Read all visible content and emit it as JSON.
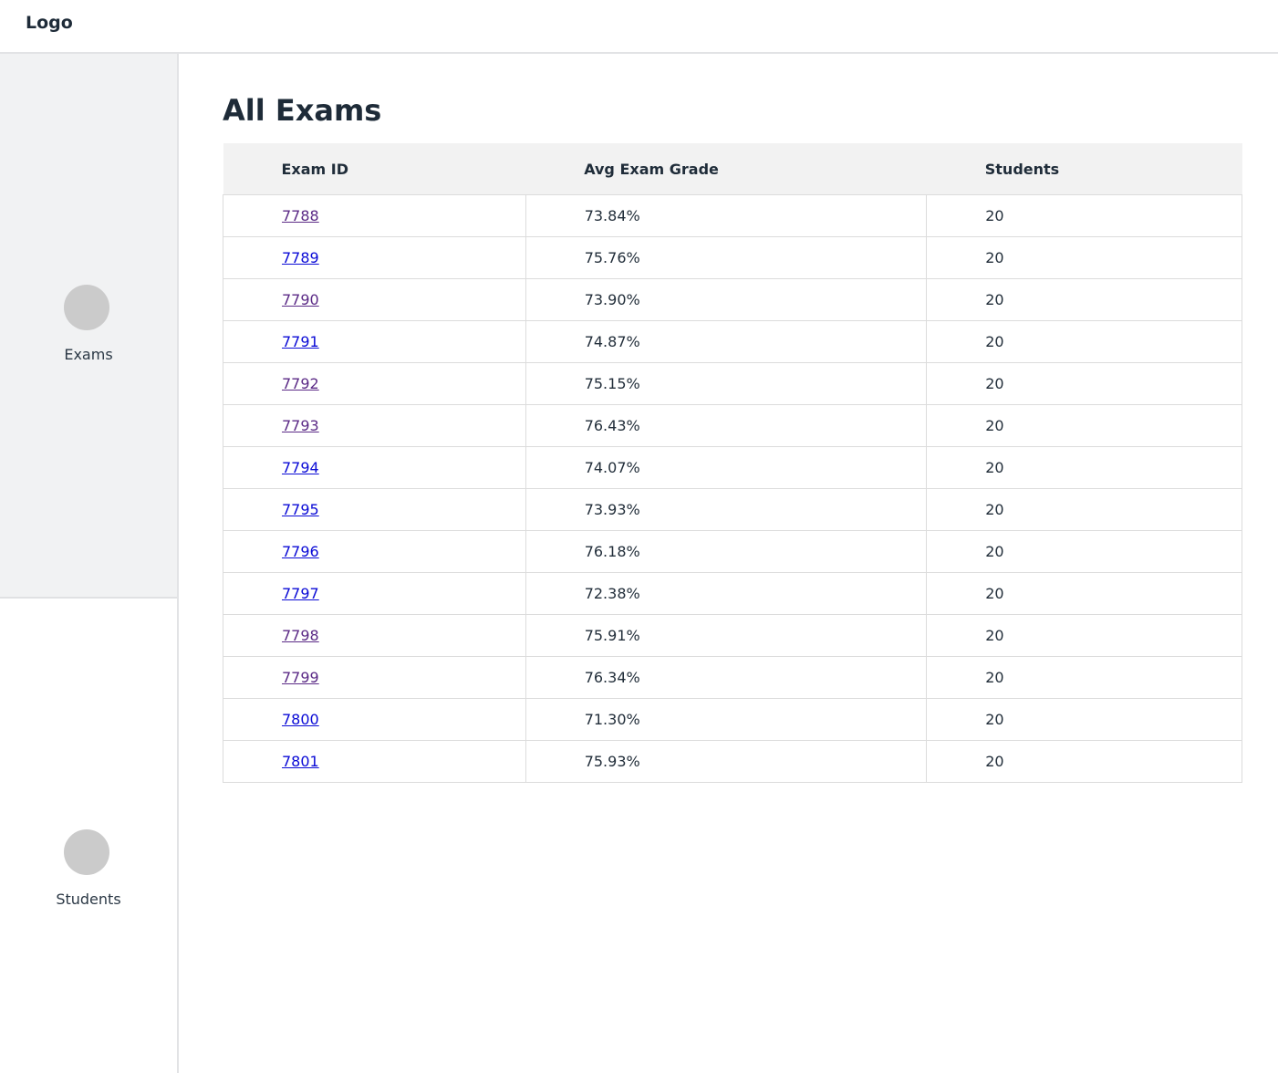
{
  "header": {
    "logo": "Logo"
  },
  "sidebar": {
    "items": [
      {
        "label": "Exams",
        "active": true,
        "icon": "circle-placeholder-icon"
      },
      {
        "label": "Students",
        "active": false,
        "icon": "circle-placeholder-icon"
      }
    ]
  },
  "main": {
    "title": "All Exams",
    "table": {
      "columns": [
        "Exam ID",
        "Avg Exam Grade",
        "Students"
      ],
      "rows": [
        {
          "exam_id": "7788",
          "avg_grade": "73.84%",
          "students": "20",
          "visited": true
        },
        {
          "exam_id": "7789",
          "avg_grade": "75.76%",
          "students": "20",
          "visited": false
        },
        {
          "exam_id": "7790",
          "avg_grade": "73.90%",
          "students": "20",
          "visited": true
        },
        {
          "exam_id": "7791",
          "avg_grade": "74.87%",
          "students": "20",
          "visited": false
        },
        {
          "exam_id": "7792",
          "avg_grade": "75.15%",
          "students": "20",
          "visited": true
        },
        {
          "exam_id": "7793",
          "avg_grade": "76.43%",
          "students": "20",
          "visited": true
        },
        {
          "exam_id": "7794",
          "avg_grade": "74.07%",
          "students": "20",
          "visited": false
        },
        {
          "exam_id": "7795",
          "avg_grade": "73.93%",
          "students": "20",
          "visited": false
        },
        {
          "exam_id": "7796",
          "avg_grade": "76.18%",
          "students": "20",
          "visited": false
        },
        {
          "exam_id": "7797",
          "avg_grade": "72.38%",
          "students": "20",
          "visited": false
        },
        {
          "exam_id": "7798",
          "avg_grade": "75.91%",
          "students": "20",
          "visited": true
        },
        {
          "exam_id": "7799",
          "avg_grade": "76.34%",
          "students": "20",
          "visited": true
        },
        {
          "exam_id": "7800",
          "avg_grade": "71.30%",
          "students": "20",
          "visited": false
        },
        {
          "exam_id": "7801",
          "avg_grade": "75.93%",
          "students": "20",
          "visited": false
        }
      ]
    }
  },
  "colors": {
    "link": "#0a0ad6",
    "link_visited": "#5b2a86",
    "sidebar_active_bg": "#f1f2f3",
    "table_header_bg": "#f2f2f2",
    "placeholder_icon": "#cbcbcb"
  }
}
